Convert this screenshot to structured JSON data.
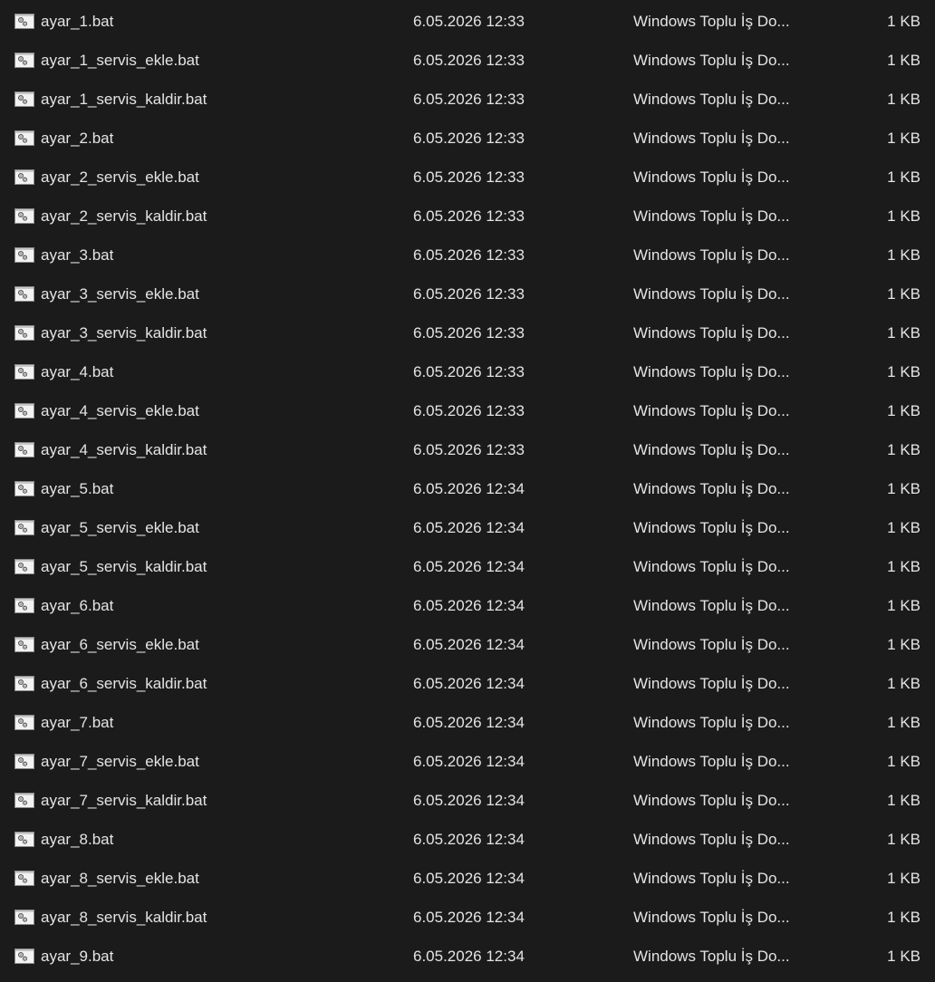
{
  "files": [
    {
      "name": "ayar_1.bat",
      "modified": "6.05.2026 12:33",
      "type": "Windows Toplu İş Do...",
      "size": "1 KB",
      "icon": "batch-file-icon"
    },
    {
      "name": "ayar_1_servis_ekle.bat",
      "modified": "6.05.2026 12:33",
      "type": "Windows Toplu İş Do...",
      "size": "1 KB",
      "icon": "batch-file-icon"
    },
    {
      "name": "ayar_1_servis_kaldir.bat",
      "modified": "6.05.2026 12:33",
      "type": "Windows Toplu İş Do...",
      "size": "1 KB",
      "icon": "batch-file-icon"
    },
    {
      "name": "ayar_2.bat",
      "modified": "6.05.2026 12:33",
      "type": "Windows Toplu İş Do...",
      "size": "1 KB",
      "icon": "batch-file-icon"
    },
    {
      "name": "ayar_2_servis_ekle.bat",
      "modified": "6.05.2026 12:33",
      "type": "Windows Toplu İş Do...",
      "size": "1 KB",
      "icon": "batch-file-icon"
    },
    {
      "name": "ayar_2_servis_kaldir.bat",
      "modified": "6.05.2026 12:33",
      "type": "Windows Toplu İş Do...",
      "size": "1 KB",
      "icon": "batch-file-icon"
    },
    {
      "name": "ayar_3.bat",
      "modified": "6.05.2026 12:33",
      "type": "Windows Toplu İş Do...",
      "size": "1 KB",
      "icon": "batch-file-icon"
    },
    {
      "name": "ayar_3_servis_ekle.bat",
      "modified": "6.05.2026 12:33",
      "type": "Windows Toplu İş Do...",
      "size": "1 KB",
      "icon": "batch-file-icon"
    },
    {
      "name": "ayar_3_servis_kaldir.bat",
      "modified": "6.05.2026 12:33",
      "type": "Windows Toplu İş Do...",
      "size": "1 KB",
      "icon": "batch-file-icon"
    },
    {
      "name": "ayar_4.bat",
      "modified": "6.05.2026 12:33",
      "type": "Windows Toplu İş Do...",
      "size": "1 KB",
      "icon": "batch-file-icon"
    },
    {
      "name": "ayar_4_servis_ekle.bat",
      "modified": "6.05.2026 12:33",
      "type": "Windows Toplu İş Do...",
      "size": "1 KB",
      "icon": "batch-file-icon"
    },
    {
      "name": "ayar_4_servis_kaldir.bat",
      "modified": "6.05.2026 12:33",
      "type": "Windows Toplu İş Do...",
      "size": "1 KB",
      "icon": "batch-file-icon"
    },
    {
      "name": "ayar_5.bat",
      "modified": "6.05.2026 12:34",
      "type": "Windows Toplu İş Do...",
      "size": "1 KB",
      "icon": "batch-file-icon"
    },
    {
      "name": "ayar_5_servis_ekle.bat",
      "modified": "6.05.2026 12:34",
      "type": "Windows Toplu İş Do...",
      "size": "1 KB",
      "icon": "batch-file-icon"
    },
    {
      "name": "ayar_5_servis_kaldir.bat",
      "modified": "6.05.2026 12:34",
      "type": "Windows Toplu İş Do...",
      "size": "1 KB",
      "icon": "batch-file-icon"
    },
    {
      "name": "ayar_6.bat",
      "modified": "6.05.2026 12:34",
      "type": "Windows Toplu İş Do...",
      "size": "1 KB",
      "icon": "batch-file-icon"
    },
    {
      "name": "ayar_6_servis_ekle.bat",
      "modified": "6.05.2026 12:34",
      "type": "Windows Toplu İş Do...",
      "size": "1 KB",
      "icon": "batch-file-icon"
    },
    {
      "name": "ayar_6_servis_kaldir.bat",
      "modified": "6.05.2026 12:34",
      "type": "Windows Toplu İş Do...",
      "size": "1 KB",
      "icon": "batch-file-icon"
    },
    {
      "name": "ayar_7.bat",
      "modified": "6.05.2026 12:34",
      "type": "Windows Toplu İş Do...",
      "size": "1 KB",
      "icon": "batch-file-icon"
    },
    {
      "name": "ayar_7_servis_ekle.bat",
      "modified": "6.05.2026 12:34",
      "type": "Windows Toplu İş Do...",
      "size": "1 KB",
      "icon": "batch-file-icon"
    },
    {
      "name": "ayar_7_servis_kaldir.bat",
      "modified": "6.05.2026 12:34",
      "type": "Windows Toplu İş Do...",
      "size": "1 KB",
      "icon": "batch-file-icon"
    },
    {
      "name": "ayar_8.bat",
      "modified": "6.05.2026 12:34",
      "type": "Windows Toplu İş Do...",
      "size": "1 KB",
      "icon": "batch-file-icon"
    },
    {
      "name": "ayar_8_servis_ekle.bat",
      "modified": "6.05.2026 12:34",
      "type": "Windows Toplu İş Do...",
      "size": "1 KB",
      "icon": "batch-file-icon"
    },
    {
      "name": "ayar_8_servis_kaldir.bat",
      "modified": "6.05.2026 12:34",
      "type": "Windows Toplu İş Do...",
      "size": "1 KB",
      "icon": "batch-file-icon"
    },
    {
      "name": "ayar_9.bat",
      "modified": "6.05.2026 12:34",
      "type": "Windows Toplu İş Do...",
      "size": "1 KB",
      "icon": "batch-file-icon"
    }
  ],
  "colors": {
    "background": "#1b1b1b",
    "text": "#e4e4e4"
  }
}
